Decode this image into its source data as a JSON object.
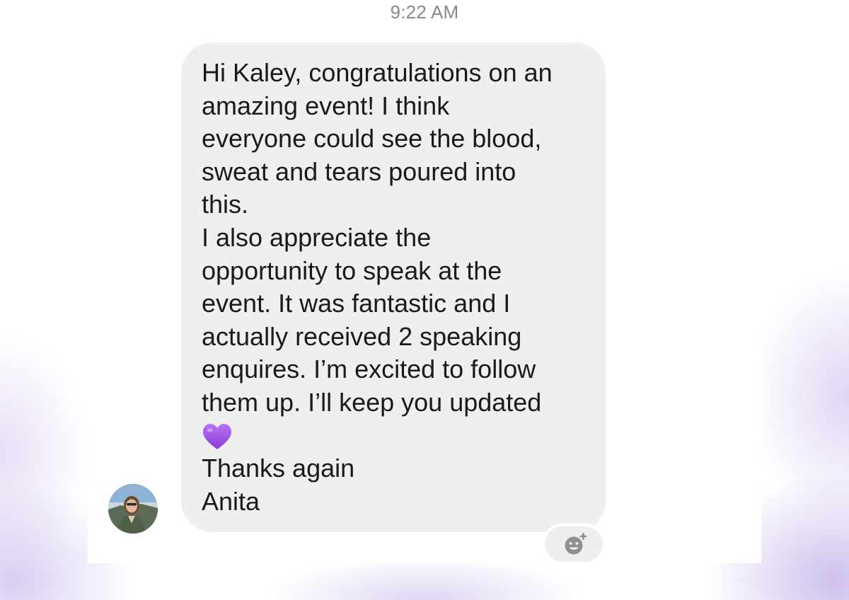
{
  "chat": {
    "timestamp": "9:22 AM",
    "message": {
      "lines_before_heart": [
        "Hi Kaley, congratulations on an",
        "amazing event! I think",
        "everyone could see the blood,",
        "sweat and tears poured into",
        "this.",
        "I also appreciate the",
        "opportunity to speak at the",
        "event. It was fantastic and I",
        "actually received 2 speaking",
        "enquires. I’m excited to follow",
        "them up. I’ll keep you updated"
      ],
      "emoji": "purple-heart",
      "lines_after_heart": [
        "Thanks again",
        "Anita"
      ]
    },
    "sender": {
      "avatar_icon": "profile-photo"
    },
    "reaction_button": {
      "icon": "add-reaction-icon"
    }
  },
  "colors": {
    "bubble": "#efefef",
    "text": "#1a1a1a",
    "timestamp": "#8a8a8a",
    "heart": "#9b4be0",
    "page_tint": "#c8b9eb"
  }
}
